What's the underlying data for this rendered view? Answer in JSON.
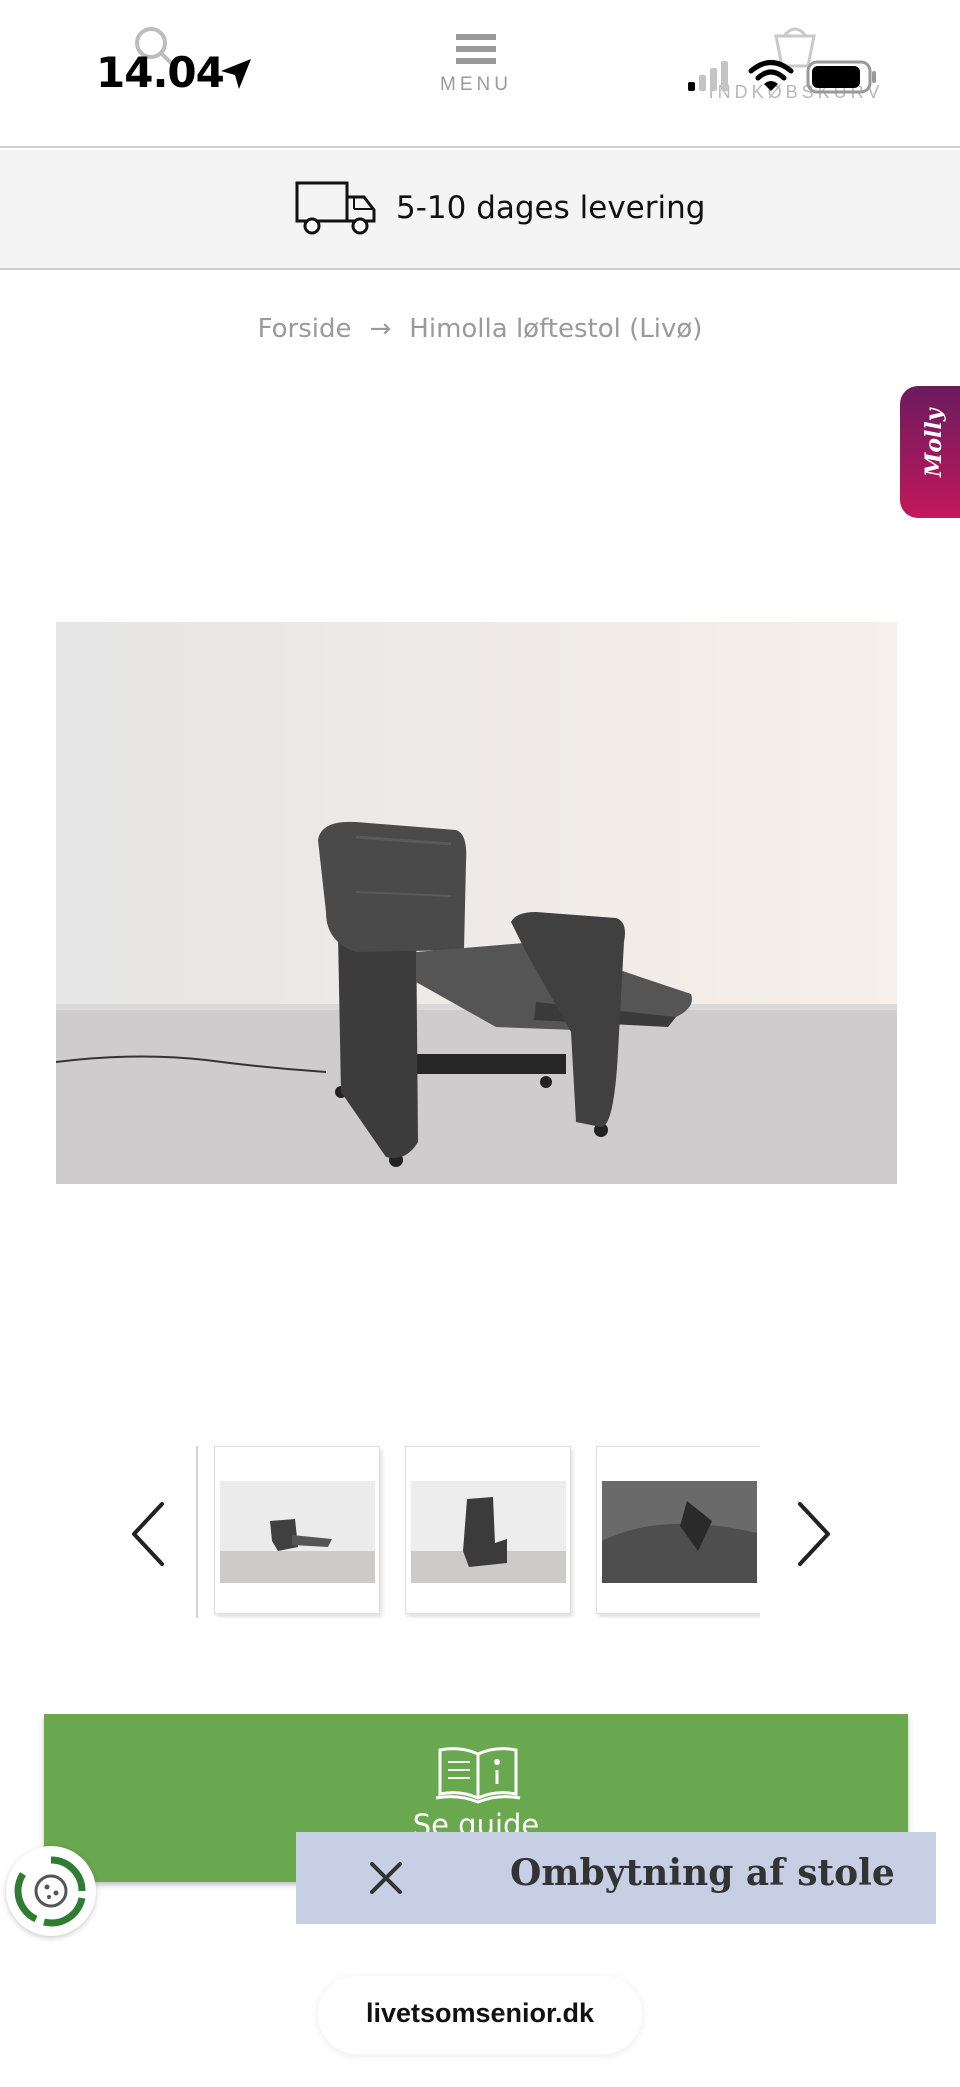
{
  "status_bar": {
    "time": "14.04"
  },
  "header": {
    "menu_label": "MENU",
    "cart_label": "INDKØBSKURV"
  },
  "delivery": {
    "text": "5-10 dages levering"
  },
  "breadcrumb": {
    "home": "Forside",
    "separator": "→",
    "current": "Himolla løftestol (Livø)"
  },
  "chat_widget": {
    "label": "Molly"
  },
  "guide": {
    "label": "Se guide"
  },
  "exchange_banner": {
    "text": "Ombytning af stole"
  },
  "browser": {
    "url": "livetsomsenior.dk"
  },
  "colors": {
    "guide_green": "#6aa84f",
    "banner_blue": "#c7cfe4",
    "molly_gradient_top": "#6a1b5e",
    "molly_gradient_bottom": "#c4175c"
  },
  "icons": [
    "location-icon",
    "search-icon",
    "menu-icon",
    "cart-icon",
    "signal-icon",
    "wifi-icon",
    "battery-icon",
    "truck-icon",
    "chevron-left-icon",
    "chevron-right-icon",
    "book-icon",
    "cookie-icon",
    "close-icon"
  ]
}
